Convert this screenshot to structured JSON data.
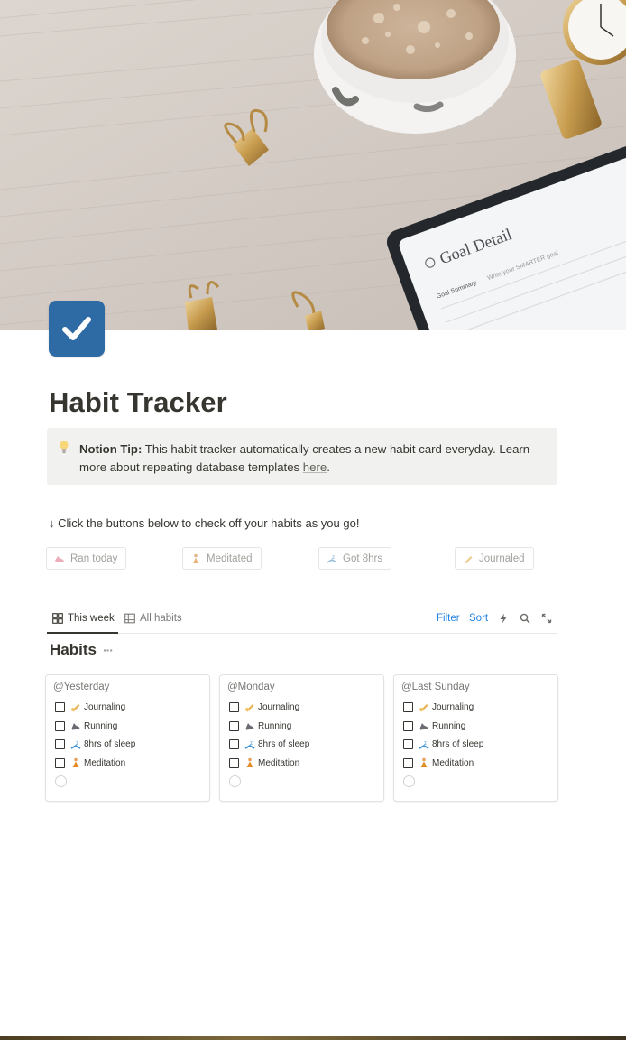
{
  "cover": {
    "notebook_title": "Goal Detail",
    "notebook_summary_label": "Goal Summary",
    "notebook_summary_hint": "Write your SMARTER goal"
  },
  "page": {
    "icon": "checkbox-icon",
    "title": "Habit Tracker"
  },
  "callout": {
    "icon": "lightbulb-icon",
    "bold": "Notion Tip:",
    "text": " This habit tracker automatically creates a new habit card everyday. Learn more about repeating database templates ",
    "link": "here",
    "end": "."
  },
  "instruction": "↓ Click the buttons below to check off your habits as you go!",
  "buttons": [
    {
      "label": "Ran today",
      "icon": "running-shoe-icon"
    },
    {
      "label": "Meditated",
      "icon": "meditation-icon"
    },
    {
      "label": "Got 8hrs",
      "icon": "sleep-icon"
    },
    {
      "label": "Journaled",
      "icon": "writing-hand-icon"
    }
  ],
  "views": {
    "tabs": [
      {
        "label": "This week",
        "icon": "gallery-icon",
        "active": true
      },
      {
        "label": "All habits",
        "icon": "table-icon",
        "active": false
      }
    ],
    "filter": "Filter",
    "sort": "Sort",
    "tool_icons": [
      "lightning-icon",
      "search-icon",
      "expand-icon"
    ]
  },
  "database": {
    "title": "Habits",
    "more": "···"
  },
  "cards": [
    {
      "title": "@Yesterday",
      "habits": [
        "Journaling",
        "Running",
        "8hrs of sleep",
        "Meditation"
      ]
    },
    {
      "title": "@Monday",
      "habits": [
        "Journaling",
        "Running",
        "8hrs of sleep",
        "Meditation"
      ]
    },
    {
      "title": "@Last Sunday",
      "habits": [
        "Journaling",
        "Running",
        "8hrs of sleep",
        "Meditation"
      ]
    }
  ],
  "colors": {
    "accent_blue": "#2383e2",
    "page_icon_blue": "#2e6aa3",
    "callout_bg": "#f1f1ef",
    "text": "#37352f",
    "muted": "#a3a19c"
  }
}
